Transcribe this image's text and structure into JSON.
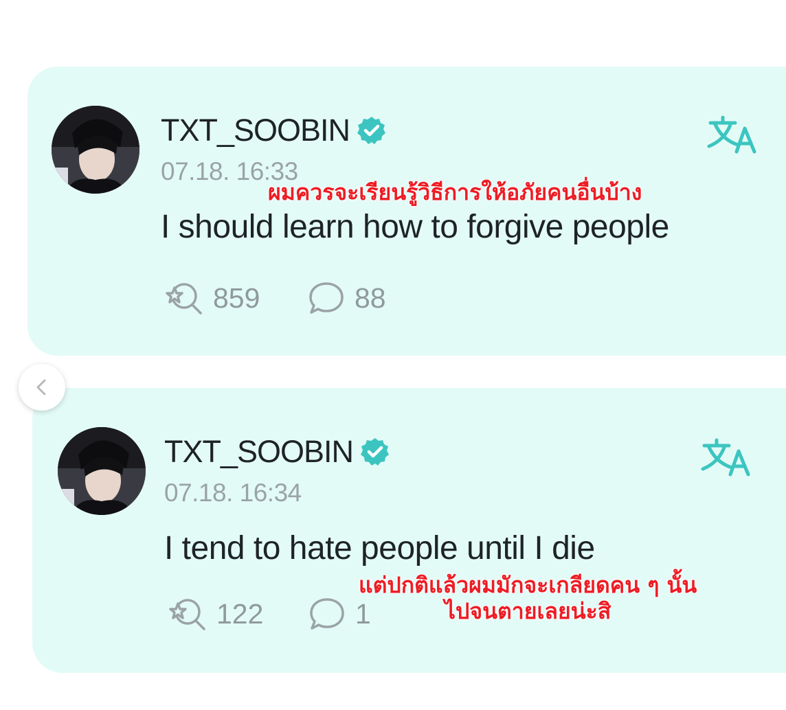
{
  "posts": [
    {
      "username": "TXT_SOOBIN",
      "timestamp": "07.18. 16:33",
      "message": "I should learn how to forgive people",
      "caption_lines": [
        "ผมควรจะเรียนรู้วิธีการให้อภัยคนอื่นบ้าง"
      ],
      "reactions": "859",
      "comments": "88"
    },
    {
      "username": "TXT_SOOBIN",
      "timestamp": "07.18. 16:34",
      "message": "I tend to hate people until I die",
      "caption_lines": [
        "แต่ปกติแล้วผมมักจะเกลียดคน ๆ นั้น",
        "ไปจนตายเลยน่ะสิ"
      ],
      "reactions": "122",
      "comments": "1"
    }
  ],
  "icons": {
    "verified": "verified-badge-icon",
    "translate": "translate-icon",
    "reaction": "reaction-icon",
    "comment": "comment-bubble-icon",
    "previous": "chevron-left-icon"
  },
  "colors": {
    "card_background": "#e3fbf7",
    "accent": "#3cc5c0",
    "caption": "#ee1c24",
    "muted_text": "#9aa3a6"
  }
}
